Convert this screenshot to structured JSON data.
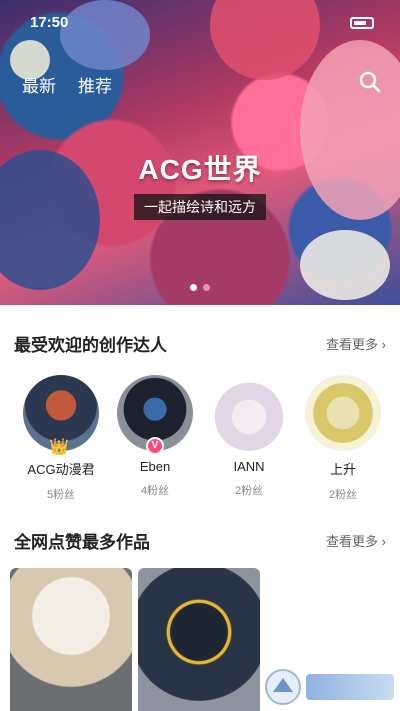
{
  "status": {
    "time": "17:50"
  },
  "nav": {
    "tabs": [
      {
        "label": "最新"
      },
      {
        "label": "推荐"
      }
    ]
  },
  "banner": {
    "title": "ACG世界",
    "subtitle": "一起描绘诗和远方"
  },
  "creators_section": {
    "title": "最受欢迎的创作达人",
    "more": "查看更多"
  },
  "creators": [
    {
      "name": "ACG动漫君",
      "fans": "5粉丝"
    },
    {
      "name": "Eben",
      "fans": "4粉丝"
    },
    {
      "name": "IANN",
      "fans": "2粉丝"
    },
    {
      "name": "上升",
      "fans": "2粉丝"
    }
  ],
  "works_section": {
    "title": "全网点赞最多作品",
    "more": "查看更多"
  },
  "colors": {
    "accent": "#ff4a7a",
    "text": "#222222",
    "muted": "#888888"
  }
}
